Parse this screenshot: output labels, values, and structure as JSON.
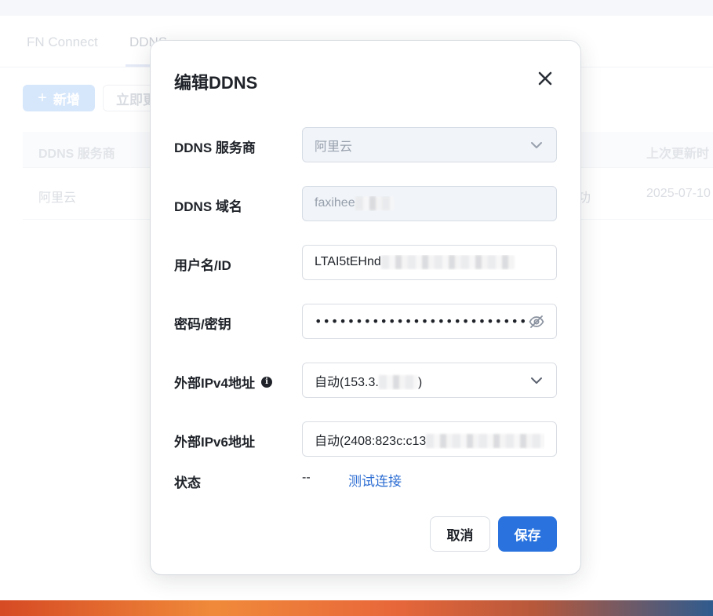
{
  "background": {
    "tabs": [
      "FN Connect",
      "DDNS"
    ],
    "add_button": "新增",
    "add_icon": "plus-icon",
    "update_now_button": "立即更",
    "table": {
      "headers": [
        "DDNS 服务商",
        "上次更新时"
      ],
      "rows": [
        {
          "provider": "阿里云",
          "status_fragment": "功",
          "last_update": "2025-07-10"
        }
      ]
    }
  },
  "modal": {
    "title": "编辑DDNS",
    "close_icon": "close-icon",
    "fields": {
      "provider": {
        "label": "DDNS 服务商",
        "value": "阿里云",
        "icon": "chevron-down-icon"
      },
      "domain": {
        "label": "DDNS 域名",
        "value": "faxihee"
      },
      "username": {
        "label": "用户名/ID",
        "value": "LTAI5tEHnd"
      },
      "secret": {
        "label": "密码/密钥",
        "value": "•••••••••••••••••••••••••••••",
        "icon": "eye-off-icon"
      },
      "ipv4": {
        "label": "外部IPv4地址",
        "info_icon": "info-icon",
        "value_prefix": "自动(153.3.",
        "value_suffix": ")",
        "icon": "chevron-down-icon"
      },
      "ipv6": {
        "label": "外部IPv6地址",
        "value": "自动(2408:823c:c13"
      },
      "status": {
        "label": "状态",
        "value": "--",
        "test_link": "测试连接"
      }
    },
    "buttons": {
      "cancel": "取消",
      "save": "保存"
    },
    "colors": {
      "primary": "#2a73de",
      "link": "#2f6fd3"
    }
  }
}
